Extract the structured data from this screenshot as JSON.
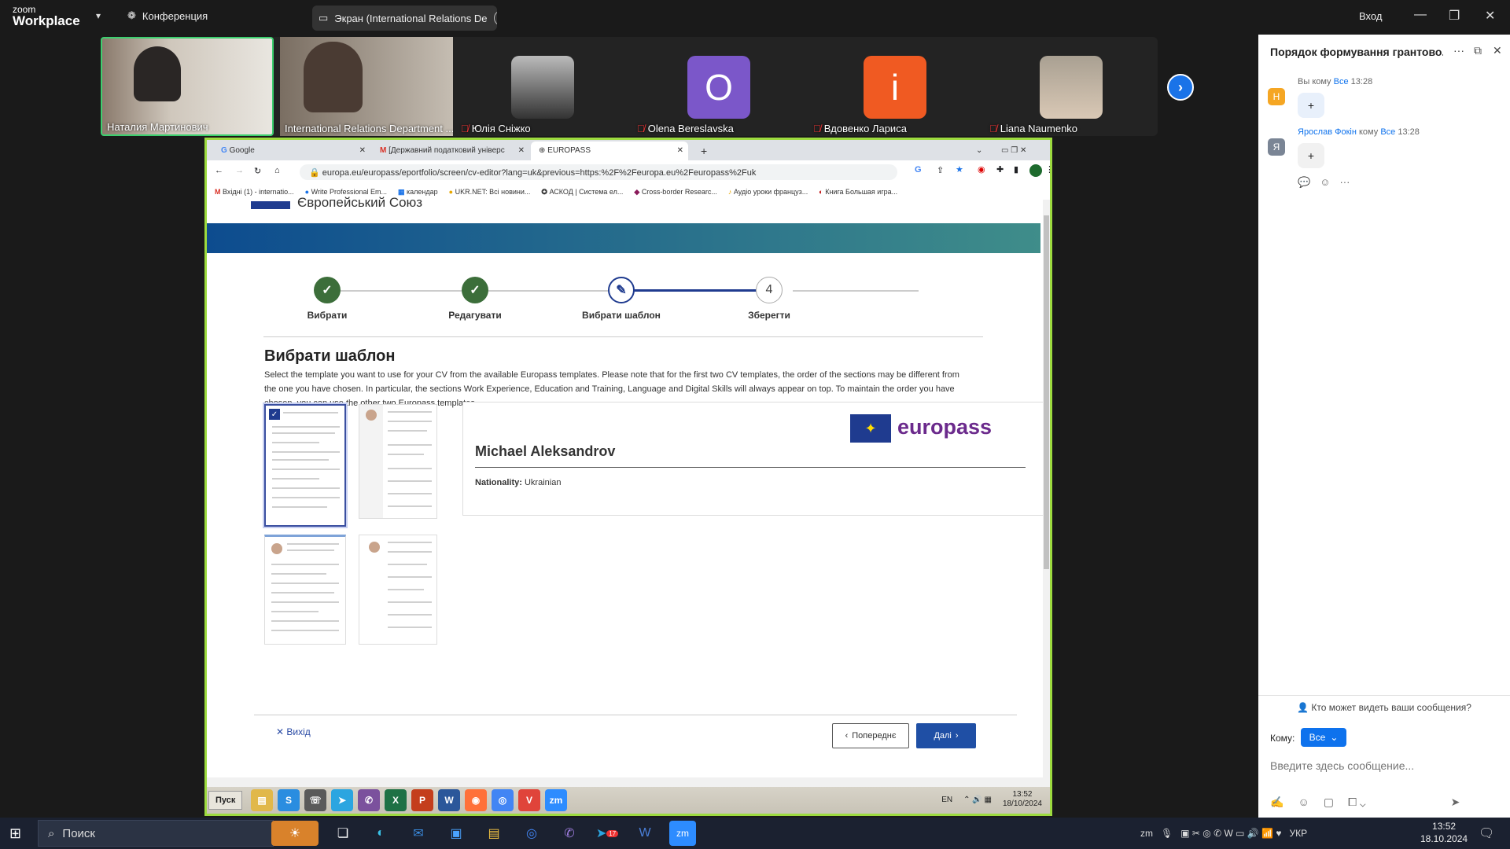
{
  "zoom": {
    "logo_line1": "zoom",
    "logo_line2": "Workplace",
    "meeting_label": "Конференция",
    "share_label": "Экран (International Relations De",
    "signin": "Вход"
  },
  "participants": [
    {
      "name": "Наталия Мартинович",
      "muted": false,
      "type": "video"
    },
    {
      "name": "International Relations Department ...",
      "muted": false,
      "type": "video"
    },
    {
      "name": "Юлія Сніжко",
      "muted": true,
      "type": "photo"
    },
    {
      "name": "Olena Bereslavska",
      "muted": true,
      "type": "letter",
      "letter": "O",
      "color": "#7b57c9"
    },
    {
      "name": "Вдовенко Лариса",
      "muted": true,
      "type": "letter",
      "letter": "i",
      "color": "#f05a22"
    },
    {
      "name": "Liana Naumenko",
      "muted": true,
      "type": "photo"
    }
  ],
  "browser": {
    "tabs": [
      "Google",
      "[Державний податковий універс",
      "EUROPASS"
    ],
    "url": "europa.eu/europass/eportfolio/screen/cv-editor?lang=uk&previous=https:%2F%2Feuropa.eu%2Feuropass%2Fuk",
    "bookmarks": [
      "Вхідні (1) - internatio...",
      "Write Professional Em...",
      "календар",
      "UKR.NET: Всі новини...",
      "АСКОД | Система ел...",
      "Cross-border Researc...",
      "Аудіо уроки француз...",
      "Книга Большая игра..."
    ]
  },
  "europass_page": {
    "header_cut": "Європейський Союз",
    "steps": [
      {
        "label": "Вибрати",
        "state": "done"
      },
      {
        "label": "Редагувати",
        "state": "done"
      },
      {
        "label": "Вибрати шаблон",
        "state": "active"
      },
      {
        "label": "Зберегти",
        "state": "todo",
        "num": "4"
      }
    ],
    "title": "Вибрати шаблон",
    "description": "Select the template you want to use for your CV from the available Europass templates. Please note that for the first two CV templates, the order of the sections may be different from the one you have chosen. In particular, the sections Work Experience, Education and Training, Language and Digital Skills will always appear on top. To maintain the order you have chosen, you can use the other two Europass templates.",
    "preview": {
      "brand": "europass",
      "name": "Michael Aleksandrov",
      "nationality_label": "Nationality:",
      "nationality_value": "Ukrainian"
    },
    "exit_label": "Вихід",
    "prev_label": "Попереднє",
    "next_label": "Далі"
  },
  "xp_taskbar": {
    "start": "Пуск",
    "lang": "EN",
    "time": "13:52",
    "date": "18/10/2024"
  },
  "chat": {
    "title": "Порядок формування грантово...",
    "messages": [
      {
        "avatar": "Н",
        "avatar_color": "#f5a623",
        "sender": "Вы",
        "to_word": "кому",
        "to": "Все",
        "time": "13:28",
        "text": "+"
      },
      {
        "avatar": "Я",
        "avatar_color": "#7a8595",
        "sender": "Ярослав Фокін",
        "to_word": "кому",
        "to": "Все",
        "time": "13:28",
        "text": "+"
      }
    ],
    "who_can_see": "Кто может видеть ваши сообщения?",
    "to_label": "Кому:",
    "to_value": "Все",
    "input_placeholder": "Введите здесь сообщение..."
  },
  "windows_taskbar": {
    "search_placeholder": "Поиск",
    "lang": "УКР",
    "time": "13:52",
    "date": "18.10.2024",
    "telegram_badge": "17"
  }
}
